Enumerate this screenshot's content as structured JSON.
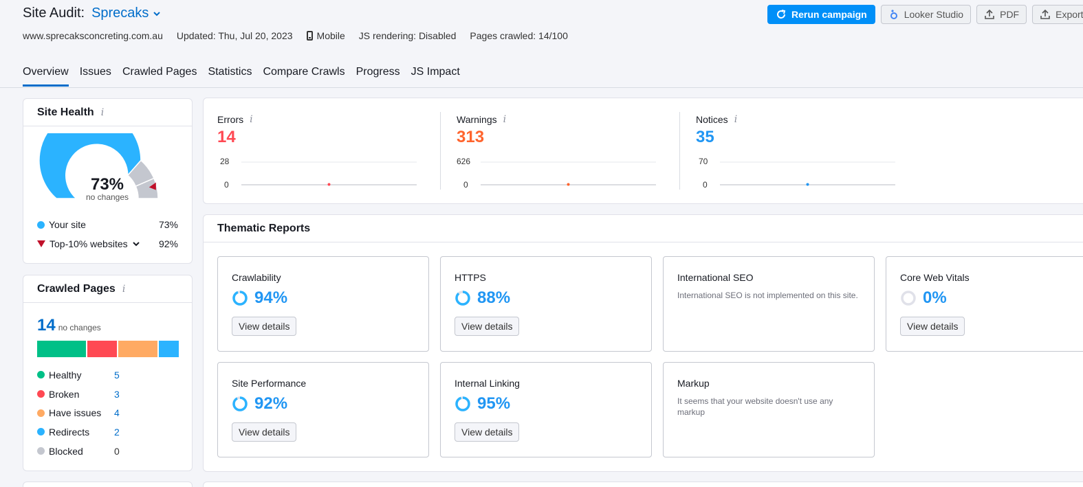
{
  "header": {
    "title": "Site Audit:",
    "project": "Sprecaks",
    "domain": "www.sprecaksconcreting.com.au",
    "updated": "Updated: Thu, Jul 20, 2023",
    "device": "Mobile",
    "js_rendering": "JS rendering: Disabled",
    "pages_crawled": "Pages crawled: 14/100"
  },
  "actions": {
    "rerun": "Rerun campaign",
    "looker": "Looker Studio",
    "pdf": "PDF",
    "export": "Export"
  },
  "tabs": [
    "Overview",
    "Issues",
    "Crawled Pages",
    "Statistics",
    "Compare Crawls",
    "Progress",
    "JS Impact"
  ],
  "site_health": {
    "title": "Site Health",
    "score": "73%",
    "score_value": 73,
    "change": "no changes",
    "your_site_label": "Your site",
    "your_site_value": "73%",
    "top10_label": "Top-10% websites",
    "top10_value": "92%",
    "top10_value_num": 92
  },
  "crawled_pages": {
    "title": "Crawled Pages",
    "count": "14",
    "change": "no changes",
    "items": [
      {
        "label": "Healthy",
        "value": "5",
        "color": "#00c087"
      },
      {
        "label": "Broken",
        "value": "3",
        "color": "#ff4953"
      },
      {
        "label": "Have issues",
        "value": "4",
        "color": "#ffaa63"
      },
      {
        "label": "Redirects",
        "value": "2",
        "color": "#2bb3ff"
      },
      {
        "label": "Blocked",
        "value": "0",
        "color": "#c4c7cf"
      }
    ]
  },
  "issues": [
    {
      "name": "Errors",
      "value": "14",
      "color": "#ff4953",
      "y_max": "28",
      "y_min": "0",
      "point": 14,
      "max": 28
    },
    {
      "name": "Warnings",
      "value": "313",
      "color": "#ff642d",
      "y_max": "626",
      "y_min": "0",
      "point": 313,
      "max": 626
    },
    {
      "name": "Notices",
      "value": "35",
      "color": "#2196f3",
      "y_max": "70",
      "y_min": "0",
      "point": 35,
      "max": 70
    }
  ],
  "thematic": {
    "title": "Thematic Reports",
    "view_details": "View details",
    "tiles": [
      {
        "name": "Crawlability",
        "score": "94%",
        "pct": 94,
        "color": "#2bb3ff"
      },
      {
        "name": "HTTPS",
        "score": "88%",
        "pct": 88,
        "color": "#2bb3ff"
      },
      {
        "name": "International SEO",
        "desc": "International SEO is not implemented on this site."
      },
      {
        "name": "Core Web Vitals",
        "score": "0%",
        "pct": 0,
        "color": "#c4c7cf"
      },
      {
        "name": "Site Performance",
        "score": "92%",
        "pct": 92,
        "color": "#2bb3ff"
      },
      {
        "name": "Internal Linking",
        "score": "95%",
        "pct": 95,
        "color": "#2bb3ff"
      },
      {
        "name": "Markup",
        "desc": "It seems that your website doesn't use any markup"
      }
    ]
  }
}
